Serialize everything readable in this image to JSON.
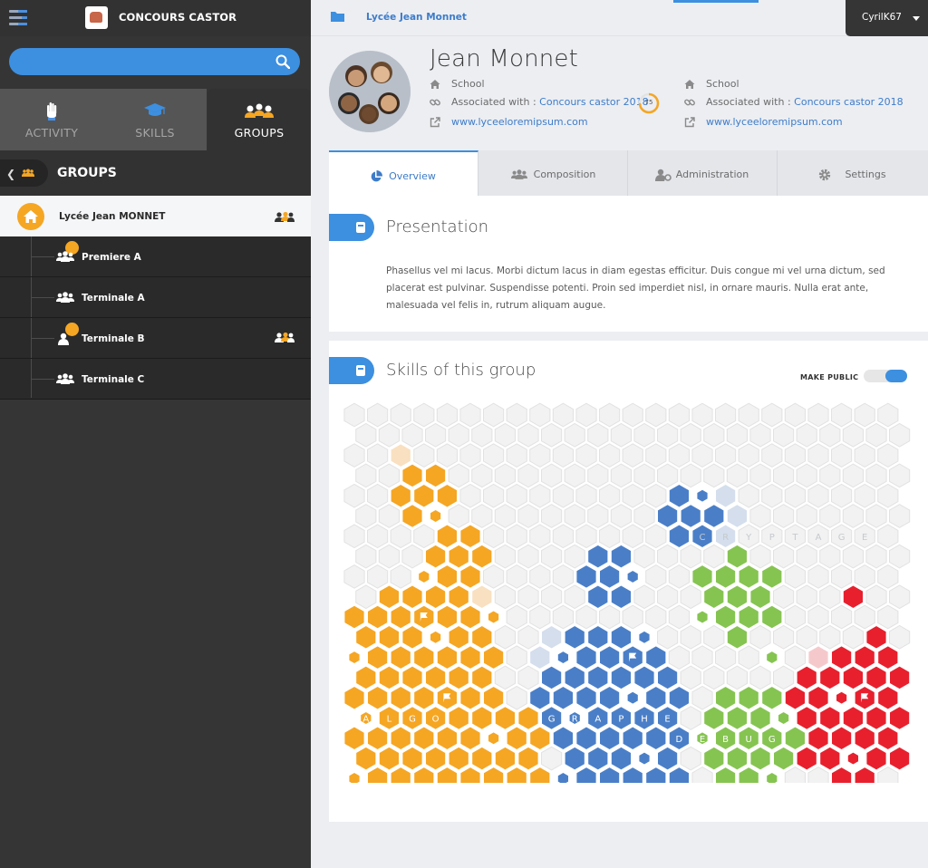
{
  "app": {
    "title": "CONCOURS CASTOR"
  },
  "search": {
    "placeholder": "",
    "value": ""
  },
  "left_tabs": [
    {
      "label": "ACTIVITY",
      "icon": "hand-icon",
      "active": false
    },
    {
      "label": "SKILLS",
      "icon": "graduation-cap-icon",
      "active": false
    },
    {
      "label": "GROUPS",
      "icon": "group-icon",
      "active": true
    }
  ],
  "groups_header": {
    "title": "GROUPS"
  },
  "school": {
    "name": "Lycée Jean MONNET"
  },
  "groups": [
    {
      "name": "Premiere A",
      "badge": true,
      "manager": false
    },
    {
      "name": "Terminale A",
      "badge": false,
      "manager": false
    },
    {
      "name": "Terminale B",
      "badge": true,
      "manager": true
    },
    {
      "name": "Terminale C",
      "badge": false,
      "manager": false
    }
  ],
  "topbar": {
    "breadcrumb": "Lycée Jean Monnet",
    "user": "CyrilK67"
  },
  "profile": {
    "name": "Jean Monnet",
    "left": {
      "type": "School",
      "assoc_prefix": "Associated with : ",
      "assoc_link": "Concours castor 2018",
      "score": "75",
      "website": "www.lyceeloremipsum.com"
    },
    "right": {
      "type": "School",
      "assoc_prefix": "Associated with : ",
      "assoc_link": "Concours castor 2018",
      "website": "www.lyceeloremipsum.com"
    }
  },
  "tabs": [
    {
      "label": "Overview",
      "icon": "pie-chart-icon",
      "active": true
    },
    {
      "label": "Composition",
      "icon": "users-icon",
      "active": false
    },
    {
      "label": "Administration",
      "icon": "user-gear-icon",
      "active": false
    },
    {
      "label": "Settings",
      "icon": "gear-icon",
      "active": false
    }
  ],
  "presentation": {
    "title": "Presentation",
    "text": "Phasellus vel mi lacus. Morbi dictum lacus in diam egestas efficitur. Duis congue mi vel urna dictum, sed placerat est pulvinar. Suspendisse potenti. Proin sed imperdiet nisl, in ornare mauris. Nulla erat ante, malesuada vel felis in, rutrum aliquam augue."
  },
  "skills": {
    "title": "Skills of this group",
    "make_public_label": "MAKE PUBLIC",
    "make_public": true,
    "domains": [
      {
        "word": "ALGO",
        "color": "#f5a623"
      },
      {
        "word": "GRAPHE",
        "color": "#4a7fc8"
      },
      {
        "word": "DEBUG",
        "color": "#86c451"
      },
      {
        "word": "CRYPTAGE",
        "color": "#d0d4da"
      }
    ],
    "colors": {
      "empty": "#f2f2f2",
      "orange": "#f5a623",
      "orange_light": "#f8e0c0",
      "blue": "#4a7fc8",
      "blue_light": "#d4deec",
      "green": "#86c451",
      "red": "#e8202e",
      "red_light": "#f5c9cc"
    }
  }
}
